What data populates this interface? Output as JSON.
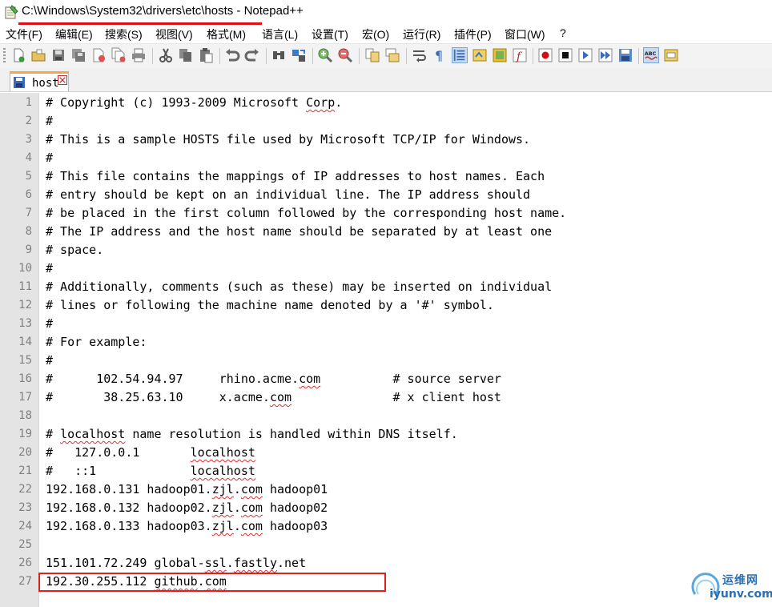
{
  "window": {
    "title": "C:\\Windows\\System32\\drivers\\etc\\hosts - Notepad++",
    "icon": "notepad-icon"
  },
  "menu": {
    "items": [
      "文件(F)",
      "编辑(E)",
      "搜索(S)",
      "视图(V)",
      "格式(M)",
      "语言(L)",
      "设置(T)",
      "宏(O)",
      "运行(R)",
      "插件(P)",
      "窗口(W)",
      "?"
    ]
  },
  "toolbar": {
    "icons": [
      "new-file-icon",
      "open-file-icon",
      "save-icon",
      "save-all-icon",
      "close-icon",
      "close-all-icon",
      "print-icon",
      "cut-icon",
      "copy-icon",
      "paste-icon",
      "undo-icon",
      "redo-icon",
      "find-icon",
      "replace-icon",
      "zoom-in-icon",
      "zoom-out-icon",
      "sync-vertical-icon",
      "sync-horizontal-icon",
      "word-wrap-icon",
      "show-all-chars-icon",
      "indent-guide-icon",
      "user-lang-icon",
      "doc-map-icon",
      "function-list-icon",
      "record-macro-icon",
      "stop-record-icon",
      "playback-macro-icon",
      "run-macro-multiple-icon",
      "save-macro-icon",
      "spell-check-icon",
      "spell-check-options-icon"
    ]
  },
  "tab": {
    "label": "host",
    "icon": "save-disk-icon"
  },
  "editor": {
    "line_numbers": [
      "1",
      "2",
      "3",
      "4",
      "5",
      "6",
      "7",
      "8",
      "9",
      "10",
      "11",
      "12",
      "13",
      "14",
      "15",
      "16",
      "17",
      "18",
      "19",
      "20",
      "21",
      "22",
      "23",
      "24",
      "25",
      "26",
      "27"
    ],
    "lines": [
      [
        {
          "t": "# Copyright (c) 1993-2009 Microsoft "
        },
        {
          "t": "Corp",
          "s": true
        },
        {
          "t": "."
        }
      ],
      [
        {
          "t": "#"
        }
      ],
      [
        {
          "t": "# This is a sample HOSTS file used by Microsoft TCP/IP for Windows."
        }
      ],
      [
        {
          "t": "#"
        }
      ],
      [
        {
          "t": "# This file contains the mappings of IP addresses to host names. Each"
        }
      ],
      [
        {
          "t": "# entry should be kept on an individual line. The IP address should"
        }
      ],
      [
        {
          "t": "# be placed in the first column followed by the corresponding host name."
        }
      ],
      [
        {
          "t": "# The IP address and the host name should be separated by at least one"
        }
      ],
      [
        {
          "t": "# space."
        }
      ],
      [
        {
          "t": "#"
        }
      ],
      [
        {
          "t": "# Additionally, comments (such as these) may be inserted on individual"
        }
      ],
      [
        {
          "t": "# lines or following the machine name denoted by a '#' symbol."
        }
      ],
      [
        {
          "t": "#"
        }
      ],
      [
        {
          "t": "# For example:"
        }
      ],
      [
        {
          "t": "#"
        }
      ],
      [
        {
          "t": "#      102.54.94.97     rhino.acme."
        },
        {
          "t": "com",
          "s": true
        },
        {
          "t": "          # source server"
        }
      ],
      [
        {
          "t": "#       38.25.63.10     x.acme."
        },
        {
          "t": "com",
          "s": true
        },
        {
          "t": "              # x client host"
        }
      ],
      [
        {
          "t": ""
        }
      ],
      [
        {
          "t": "# "
        },
        {
          "t": "localhost",
          "s": true
        },
        {
          "t": " name resolution is handled within DNS itself."
        }
      ],
      [
        {
          "t": "#   127.0.0.1       "
        },
        {
          "t": "localhost",
          "s": true
        }
      ],
      [
        {
          "t": "#   ::1             "
        },
        {
          "t": "localhost",
          "s": true
        }
      ],
      [
        {
          "t": "192.168.0.131 hadoop01."
        },
        {
          "t": "zjl",
          "s": true
        },
        {
          "t": "."
        },
        {
          "t": "com",
          "s": true
        },
        {
          "t": " hadoop01"
        }
      ],
      [
        {
          "t": "192.168.0.132 hadoop02."
        },
        {
          "t": "zjl",
          "s": true
        },
        {
          "t": "."
        },
        {
          "t": "com",
          "s": true
        },
        {
          "t": " hadoop02"
        }
      ],
      [
        {
          "t": "192.168.0.133 hadoop03."
        },
        {
          "t": "zjl",
          "s": true
        },
        {
          "t": "."
        },
        {
          "t": "com",
          "s": true
        },
        {
          "t": " hadoop03"
        }
      ],
      [
        {
          "t": ""
        }
      ],
      [
        {
          "t": "151.101.72.249 global-"
        },
        {
          "t": "ssl",
          "s": true
        },
        {
          "t": "."
        },
        {
          "t": "fastly",
          "s": true
        },
        {
          "t": ".net"
        }
      ],
      [
        {
          "t": "192.30.255.112 "
        },
        {
          "t": "github",
          "s": true
        },
        {
          "t": "."
        },
        {
          "t": "com",
          "s": true
        }
      ]
    ]
  },
  "watermark": {
    "text_cn": "运维网",
    "domain": "iyunv.com"
  },
  "colors": {
    "annotation_red": "#e02020",
    "gutter_bg": "#e4e4e4",
    "tab_accent": "#f3a64c",
    "watermark_blue": "#2a6fb5"
  }
}
